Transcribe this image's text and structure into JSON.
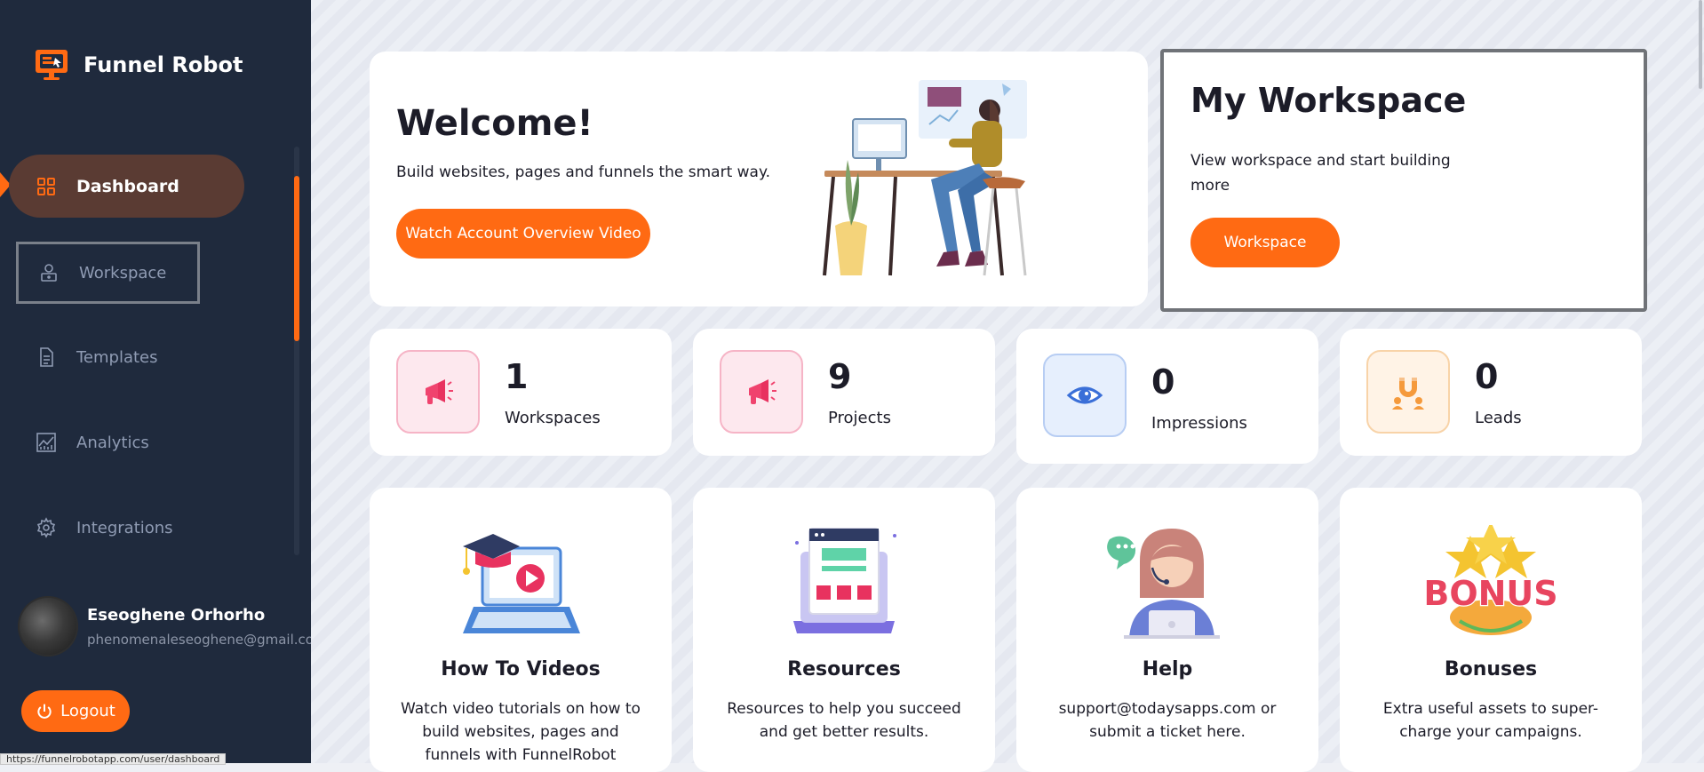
{
  "app": {
    "name": "Funnel Robot"
  },
  "sidebar": {
    "items": [
      {
        "label": "Dashboard",
        "icon": "grid-icon",
        "active": true
      },
      {
        "label": "Workspace",
        "icon": "workspace-icon"
      },
      {
        "label": "Templates",
        "icon": "document-icon"
      },
      {
        "label": "Analytics",
        "icon": "analytics-icon"
      },
      {
        "label": "Integrations",
        "icon": "gear-icon"
      }
    ]
  },
  "user": {
    "name": "Eseoghene Orhorho",
    "email": "phenomenaleseoghene@gmail.com"
  },
  "logout_label": "Logout",
  "status_url": "https://funnelrobotapp.com/user/dashboard",
  "welcome": {
    "title": "Welcome!",
    "subtitle": "Build websites, pages and funnels the smart way.",
    "button": "Watch Account Overview Video"
  },
  "workspace_card": {
    "title": "My Workspace",
    "description": "View workspace and start building more",
    "button": "Workspace"
  },
  "stats": [
    {
      "value": "1",
      "label": "Workspaces",
      "icon": "megaphone-icon"
    },
    {
      "value": "9",
      "label": "Projects",
      "icon": "megaphone-icon"
    },
    {
      "value": "0",
      "label": "Impressions",
      "icon": "eye-icon"
    },
    {
      "value": "0",
      "label": "Leads",
      "icon": "magnet-icon"
    }
  ],
  "features": [
    {
      "title": "How To Videos",
      "text": "Watch video tutorials on how to build websites, pages and funnels with FunnelRobot"
    },
    {
      "title": "Resources",
      "text": "Resources to help you succeed and get better results."
    },
    {
      "title": "Help",
      "text": "support@todaysapps.com or submit a ticket here."
    },
    {
      "title": "Bonuses",
      "text": "Extra useful assets to super-charge your campaigns.",
      "badge": "BONUS"
    }
  ],
  "colors": {
    "accent": "#ff6a13",
    "sidebar": "#1f2a3d",
    "active_item": "#5a3b33"
  }
}
